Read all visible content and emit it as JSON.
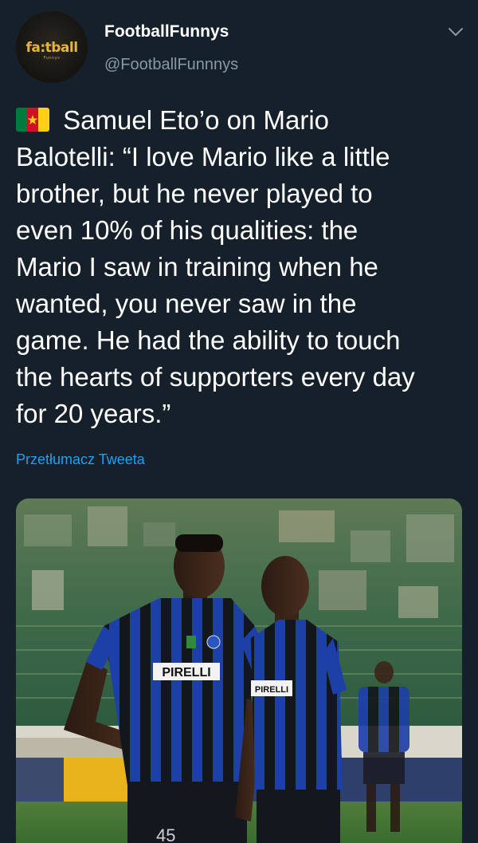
{
  "author": {
    "display_name": "FootballFunnys",
    "handle": "@FootballFunnnys",
    "avatar_logo_text": "fa:tball",
    "avatar_sub_text": "Funnys"
  },
  "tweet": {
    "flag_icon": "cameroon-flag",
    "text": " Samuel Eto’o on Mario\nBalotelli: “I love Mario like a little\nbrother, but he never played to\neven 10% of his qualities: the\nMario I saw in training when he\nwanted, you never saw in the\ngame. He had the ability to touch\nthe hearts of supporters every day\nfor 20 years.”",
    "translate_label": "Przetłumacz Tweeta"
  },
  "media": {
    "description_icon": "photo",
    "shirt_sponsor_left": "PIRELLI",
    "shirt_sponsor_right": "PIRELLI",
    "shorts_number": "45"
  },
  "colors": {
    "background": "#15202b",
    "text_primary": "#ffffff",
    "text_secondary": "#8899a6",
    "link": "#1da1f2"
  }
}
